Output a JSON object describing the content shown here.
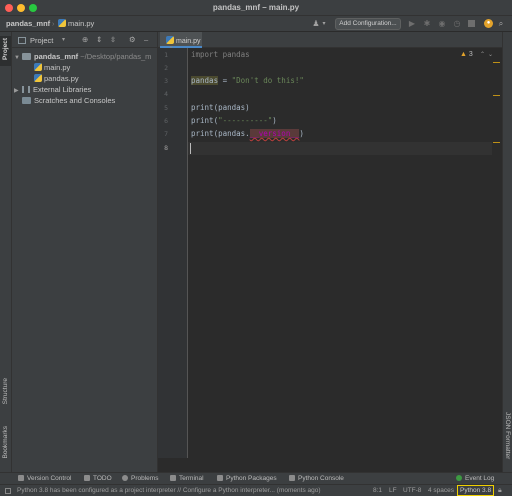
{
  "window": {
    "title": "pandas_mnf – main.py"
  },
  "navbar": {
    "project": "pandas_mnf",
    "file": "main.py",
    "add_configuration": "Add Configuration..."
  },
  "stripe": {
    "left_top": "Project",
    "left_structure": "Structure",
    "left_bookmarks": "Bookmarks",
    "right": "JSON Formatter"
  },
  "project_panel": {
    "view_selector": "Project",
    "root_name": "pandas_mnf",
    "root_path": "~/Desktop/pandas_m",
    "files": [
      "main.py",
      "pandas.py"
    ],
    "external": "External Libraries",
    "scratches": "Scratches and Consoles"
  },
  "editor": {
    "tab_label": "main.py",
    "warning_count": "3",
    "line_numbers": [
      "1",
      "2",
      "3",
      "4",
      "5",
      "6",
      "7",
      "8"
    ],
    "lines": {
      "l1": "import pandas",
      "l3_var": "pandas",
      "l3_eq": " = ",
      "l3_str": "\"Don't do this!\"",
      "l5": "print(pandas)",
      "l6_a": "print(",
      "l6_str": "\"----------\"",
      "l6_b": ")",
      "l7_a": "print(pandas.",
      "l7_attr": "__version__",
      "l7_b": ")"
    }
  },
  "bottom_tools": [
    "Version Control",
    "TODO",
    "Problems",
    "Terminal",
    "Python Packages",
    "Python Console"
  ],
  "event_log": "Event Log",
  "status": {
    "message": "Python 3.8 has been configured as a project interpreter // Configure a Python interpreter... (moments ago)",
    "position": "8:1",
    "line_sep": "LF",
    "encoding": "UTF-8",
    "indent": "4 spaces",
    "interpreter": "Python 3.8"
  },
  "colors": {
    "accent": "#4a88c7",
    "interpreter_highlight": "#f0d000",
    "string": "#6a8759",
    "keyword_dim": "#808080",
    "attr_bg": "#6b3b3b",
    "attr_fg": "#b200b2"
  }
}
